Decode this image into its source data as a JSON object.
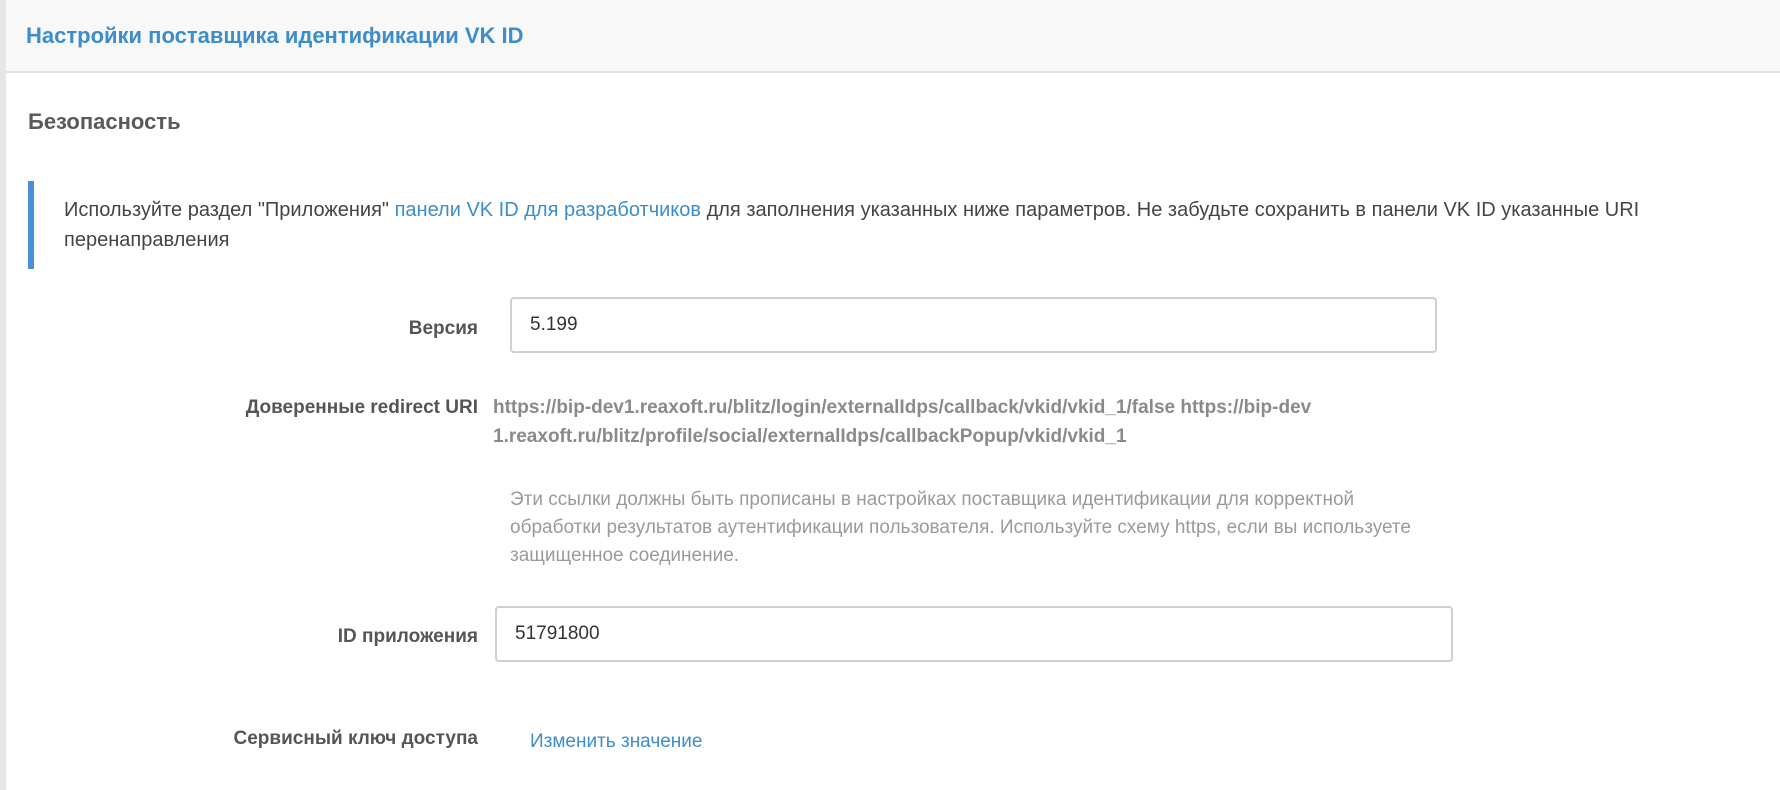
{
  "panel": {
    "title": "Настройки поставщика идентификации VK ID"
  },
  "section": {
    "title": "Безопасность"
  },
  "callout": {
    "text_before": "Используйте раздел \"Приложения\" ",
    "link_text": "панели VK ID для разработчиков",
    "text_after": " для заполнения указанных ниже параметров. Не забудьте сохранить в панели VK ID указанные URI перенаправления"
  },
  "form": {
    "version": {
      "label": "Версия",
      "value": "5.199"
    },
    "redirect_uri": {
      "label": "Доверенные redirect URI",
      "value": "https://bip-dev1.reaxoft.ru/blitz/login/externalIdps/callback/vkid/vkid_1/false https://bip-dev1.reaxoft.ru/blitz/profile/social/externalIdps/callbackPopup/vkid/vkid_1",
      "help": "Эти ссылки должны быть прописаны в настройках поставщика идентификации для корректной обработки результатов аутентификации пользователя. Используйте схему https, если вы используете защищенное соединение."
    },
    "app_id": {
      "label": "ID приложения",
      "value": "51791800"
    },
    "service_key": {
      "label": "Сервисный ключ доступа",
      "action_label": "Изменить значение"
    }
  },
  "colors": {
    "accent": "#3c8dca",
    "callout_border": "#4a90d9",
    "label": "#555555",
    "muted": "#9a9a9a"
  }
}
